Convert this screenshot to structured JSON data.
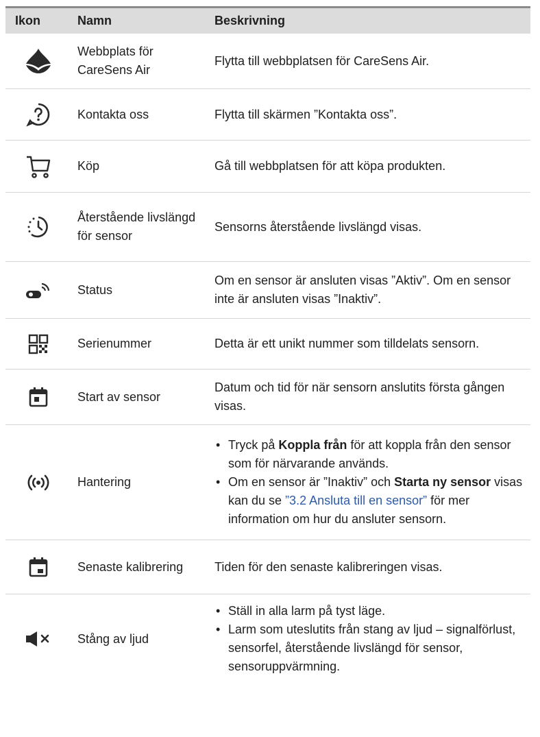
{
  "header": {
    "icon": "Ikon",
    "name": "Namn",
    "desc": "Beskrivning"
  },
  "rows": [
    {
      "icon": "water-drop-icon",
      "name": "Webbplats för CareSens Air",
      "desc": "Flytta till webbplatsen för CareSens Air."
    },
    {
      "icon": "help-circle-icon",
      "name": "Kontakta oss",
      "desc": "Flytta till skärmen ”Kontakta oss”."
    },
    {
      "icon": "cart-icon",
      "name": "Köp",
      "desc": "Gå till webbplatsen för att köpa produkten."
    },
    {
      "icon": "timer-icon",
      "name": "Återstående livslängd för sensor",
      "desc": "Sensorns återstående livslängd visas."
    },
    {
      "icon": "sensor-signal-icon",
      "name": "Status",
      "desc": "Om en sensor är ansluten visas ”Aktiv”. Om en sensor inte är ansluten visas ”Inaktiv”."
    },
    {
      "icon": "qr-code-icon",
      "name": "Serienummer",
      "desc": "Detta är ett unikt nummer som tilldelats sensorn."
    },
    {
      "icon": "calendar-icon",
      "name": "Start av sensor",
      "desc": "Datum och tid för när sensorn anslutits första gången visas."
    },
    {
      "icon": "broadcast-icon",
      "name": "Hantering",
      "bullet1_a": "Tryck på ",
      "bullet1_b": "Koppla från",
      "bullet1_c": " för att koppla från den sensor som för närvarande används.",
      "bullet2_a": "Om en sensor är ”Inaktiv” och ",
      "bullet2_b": "Starta ny sensor",
      "bullet2_c": " visas kan du se ",
      "bullet2_link": "”3.2 Ansluta till en sensor”",
      "bullet2_d": " för mer information om hur du ansluter sensorn."
    },
    {
      "icon": "calendar-icon",
      "name": "Senaste kalibrering",
      "desc": "Tiden för den senaste kalibreringen visas."
    },
    {
      "icon": "mute-icon",
      "name": "Stång av ljud",
      "bullet1": "Ställ in alla larm på tyst läge.",
      "bullet2": "Larm som uteslutits från stang av ljud – signalförlust, sensorfel, återstående livslängd för sensor, sensoruppvärmning."
    }
  ],
  "colors": {
    "link": "#2f5aa8",
    "header_bg": "#dcdcdc",
    "rule": "#8a8a8a"
  }
}
